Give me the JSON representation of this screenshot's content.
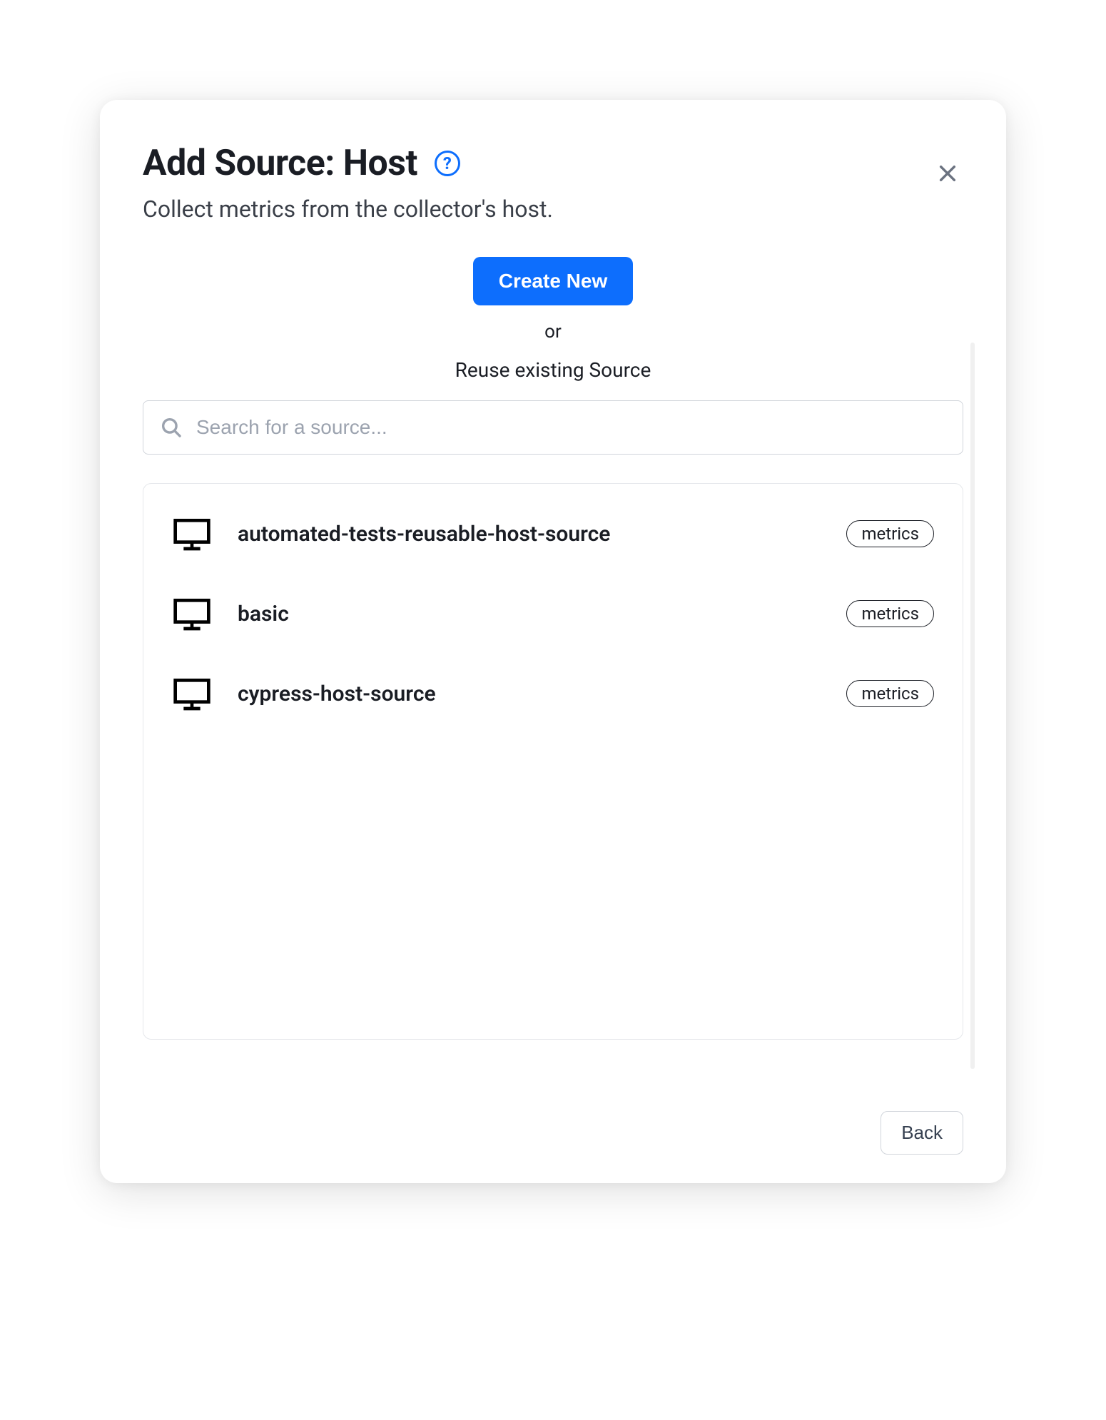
{
  "header": {
    "title": "Add Source: Host",
    "subtitle": "Collect metrics from the collector's host.",
    "help_label": "?"
  },
  "actions": {
    "create_new": "Create New",
    "or": "or",
    "reuse": "Reuse existing Source"
  },
  "search": {
    "placeholder": "Search for a source...",
    "value": ""
  },
  "sources": [
    {
      "name": "automated-tests-reusable-host-source",
      "badge": "metrics",
      "icon": "monitor-icon"
    },
    {
      "name": "basic",
      "badge": "metrics",
      "icon": "monitor-icon"
    },
    {
      "name": "cypress-host-source",
      "badge": "metrics",
      "icon": "monitor-icon"
    }
  ],
  "footer": {
    "back": "Back"
  },
  "colors": {
    "primary": "#0d6efd",
    "text": "#1a1d24",
    "muted": "#9ca3af",
    "border": "#d1d5db"
  }
}
